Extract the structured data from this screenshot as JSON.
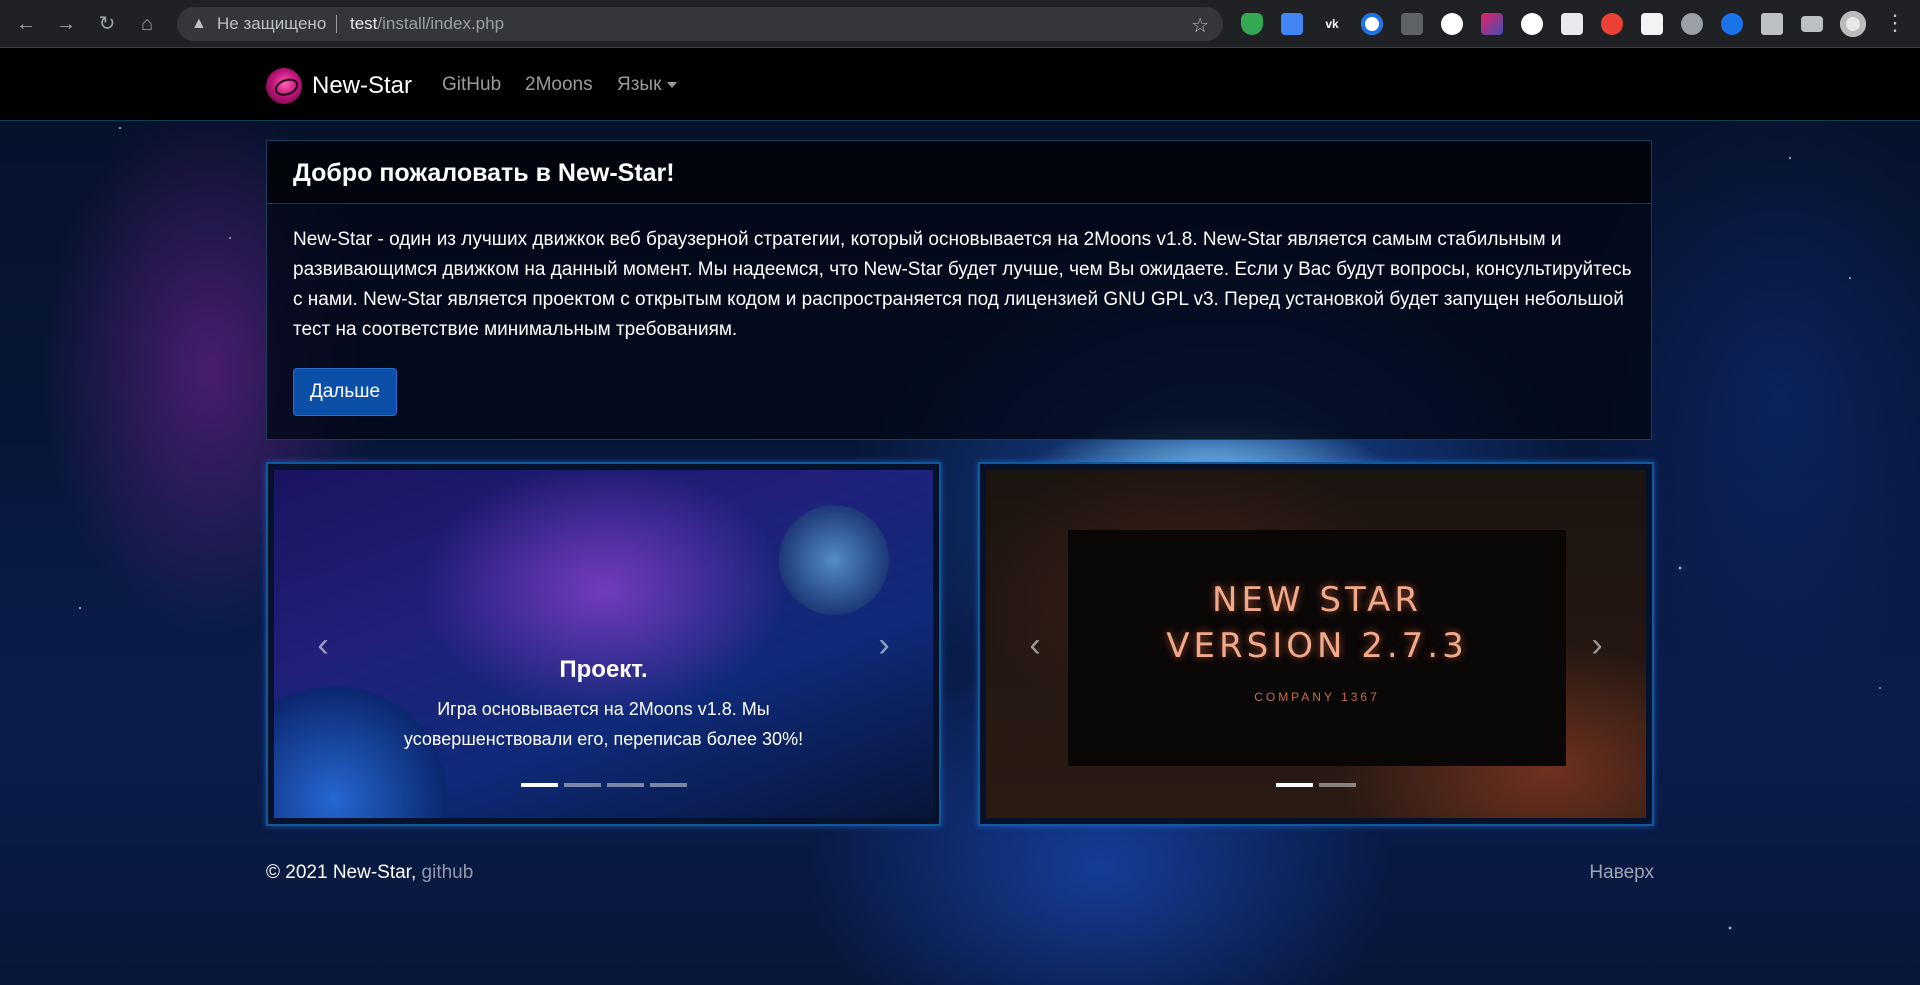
{
  "browser": {
    "security_text": "Не защищено",
    "url_host": "test",
    "url_path": "/install/index.php",
    "extensions": [
      "shield-ext",
      "translate-ext",
      "vk-ext",
      "search-ext",
      "vk-plus-ext",
      "w-ext",
      "color-ext",
      "github-ext",
      "print-ext",
      "refresh-ext",
      "w-box-ext",
      "globe-ext",
      "vpn-ext",
      "puzzle-ext",
      "media-ext"
    ]
  },
  "nav": {
    "brand": "New-Star",
    "links": [
      "GitHub",
      "2Moons"
    ],
    "language_label": "Язык"
  },
  "welcome": {
    "title": "Добро пожаловать в New-Star!",
    "body": "New-Star - один из лучших движкок веб браузерной стратегии, который основывается на 2Moons v1.8. New-Star является самым стабильным и развивающимся движком на данный момент. Мы надеемся, что New-Star будет лучше, чем Вы ожидаете. Если у Вас будут вопросы, консультируйтесь с нами. New-Star является проектом с открытым кодом и распространяется под лицензией GNU GPL v3. Перед установкой будет запущен небольшой тест на соответствие минимальным требованиям.",
    "next_button": "Дальше"
  },
  "carousel1": {
    "caption_title": "Проект.",
    "caption_text": "Игра основывается на 2Moons v1.8. Мы усовершенствовали его, переписав более 30%!",
    "slides": 4,
    "active_slide": 1
  },
  "carousel2": {
    "slide_line1": "NEW STAR",
    "slide_line2": "VERSION 2.7.3",
    "slide_company": "COMPANY 1367",
    "slides": 2,
    "active_slide": 1
  },
  "footer": {
    "copyright": "© 2021 New-Star,",
    "link": "github",
    "to_top": "Наверх"
  },
  "icons": {
    "prev": "‹",
    "next": "›"
  }
}
